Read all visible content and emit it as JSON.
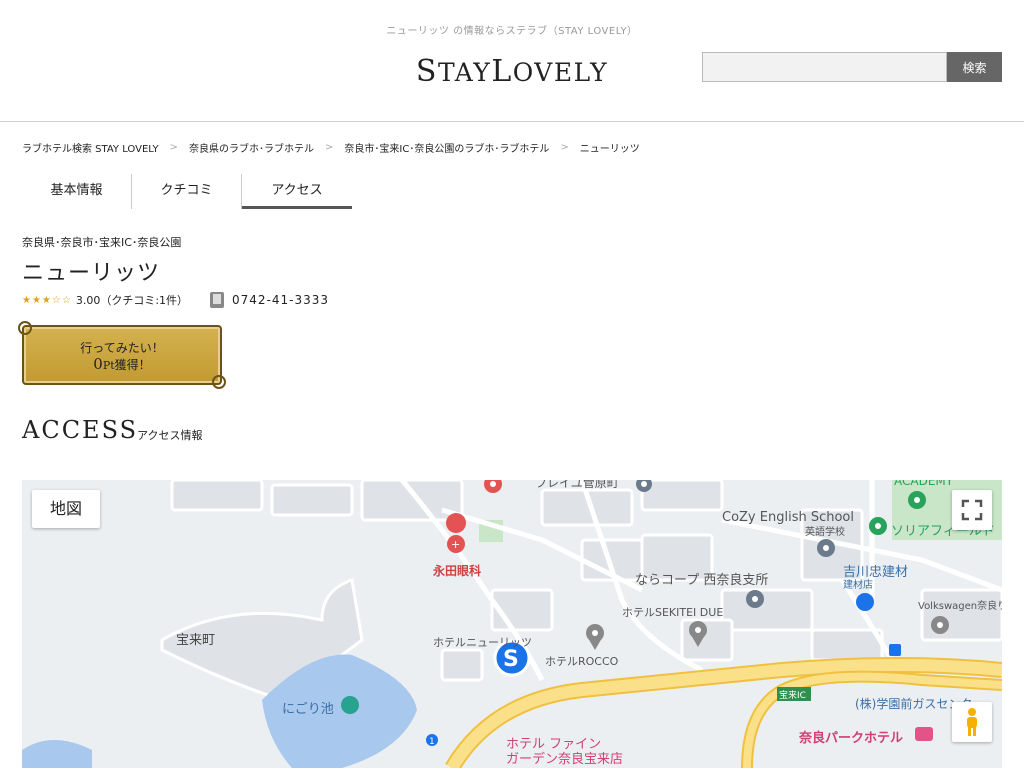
{
  "header": {
    "tagline": "ニューリッツ の情報ならステラブ（STAY LOVELY）",
    "logo": {
      "s": "S",
      "tay": "TAY",
      "l": "L",
      "ovely": "OVELY"
    },
    "search_value": "",
    "search_button": "検索"
  },
  "breadcrumb": [
    "ラブホテル検索 STAY LOVELY",
    "奈良県のラブホ･ラブホテル",
    "奈良市･宝来IC･奈良公園のラブホ･ラブホテル",
    "ニューリッツ"
  ],
  "breadcrumb_separator": ">",
  "tabs": [
    {
      "label": "基本情報",
      "active": false
    },
    {
      "label": "クチコミ",
      "active": false
    },
    {
      "label": "アクセス",
      "active": true
    }
  ],
  "hotel": {
    "area": "奈良県･奈良市･宝来IC･奈良公園",
    "name": "ニューリッツ",
    "stars": "★★★☆☆",
    "rating_text": "3.00（クチコミ:1件）",
    "phone": "0742-41-3333"
  },
  "badge": {
    "line1": "行ってみたい！",
    "points_value": "0",
    "points_unit": "Pt",
    "points_suffix": "獲得！"
  },
  "access": {
    "title": "ACCESS",
    "subtitle": "アクセス情報"
  },
  "map": {
    "type_button": "地図",
    "labels": {
      "takaracho": "宝来町",
      "nigoriike": "にごり池",
      "nagata": "永田眼科",
      "newritz": "ホテルニューリッツ",
      "rocco": "ホテルROCCO",
      "sekitei": "ホテルSEKITEI DUE",
      "narakoop": "ならコープ 西奈良支所",
      "cozy": "CoZy English School",
      "cozy_sub": "英語学校",
      "yoshikawa": "吉川忠建材",
      "yoshikawa_sub": "建材店",
      "solia": "ソリアフィールド",
      "academy": "ACADEMY",
      "vw": "Volkswagen奈良り",
      "hoticIC": "宝来IC",
      "gakuenmae": "(株)学園前ガスセンター",
      "fine1": "ホテル ファイン",
      "fine2": "ガーデン奈良宝来店",
      "narapark": "奈良パークホテル",
      "tokyodo": "フレイユ菅原町",
      "route": "1"
    },
    "colors": {
      "water": "#a8c8ee",
      "park": "#c9e6c9",
      "road_major": "#fbe08a",
      "road_edge": "#f0c040",
      "pin_red": "#e35353",
      "pin_gray": "#888888",
      "pin_green": "#27a35b",
      "pin_blue": "#1a73e8"
    }
  }
}
